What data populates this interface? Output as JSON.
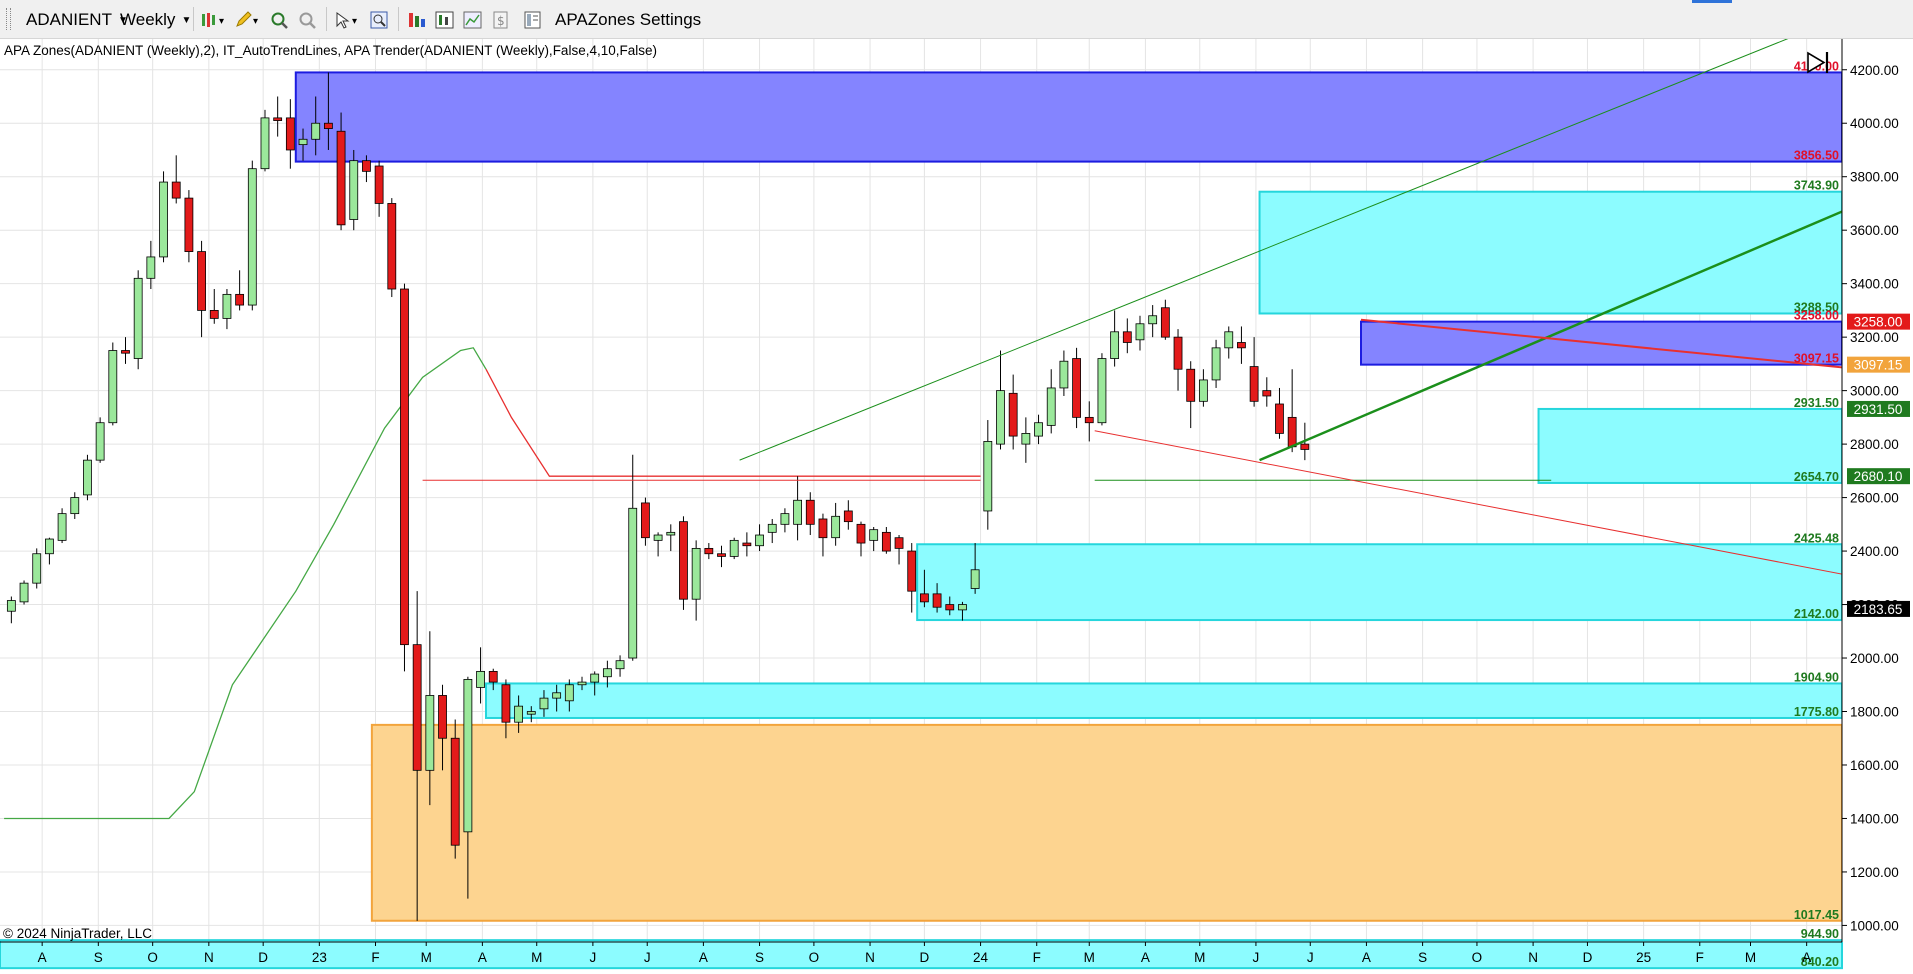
{
  "toolbar": {
    "instrument": "ADANIENT",
    "interval": "Weekly",
    "settings_label": "APAZones Settings"
  },
  "indicator_label": "APA Zones(ADANIENT (Weekly),2),  IT_AutoTrendLines, APA Trender(ADANIENT (Weekly),False,4,10,False)",
  "copyright": "© 2024 NinjaTrader, LLC",
  "colors": {
    "up_candle": "#9be89b",
    "down_candle": "#e31a1a",
    "supply_zone": "#8484ff",
    "demand_zone": "#8cfcff",
    "orange_zone": "#fdd490",
    "trend_green": "#1b8f1b",
    "trend_red": "#e83030"
  },
  "chart_data": {
    "type": "candlestick",
    "y_range": [
      938,
      4315
    ],
    "y_ticks": [
      "1000.00",
      "1200.00",
      "1400.00",
      "1600.00",
      "1800.00",
      "2000.00",
      "2200.00",
      "2400.00",
      "2600.00",
      "2800.00",
      "3000.00",
      "3200.00",
      "3400.00",
      "3600.00",
      "3800.00",
      "4000.00",
      "4200.00"
    ],
    "x_labels": [
      {
        "label": "A",
        "date": "2022-08"
      },
      {
        "label": "S",
        "date": "2022-09"
      },
      {
        "label": "O",
        "date": "2022-10"
      },
      {
        "label": "N",
        "date": "2022-11"
      },
      {
        "label": "D",
        "date": "2022-12"
      },
      {
        "label": "23",
        "date": "2023-01"
      },
      {
        "label": "F",
        "date": "2023-02"
      },
      {
        "label": "M",
        "date": "2023-03"
      },
      {
        "label": "A",
        "date": "2023-04"
      },
      {
        "label": "M",
        "date": "2023-05"
      },
      {
        "label": "J",
        "date": "2023-06"
      },
      {
        "label": "J",
        "date": "2023-07"
      },
      {
        "label": "A",
        "date": "2023-08"
      },
      {
        "label": "S",
        "date": "2023-09"
      },
      {
        "label": "O",
        "date": "2023-10"
      },
      {
        "label": "N",
        "date": "2023-11"
      },
      {
        "label": "D",
        "date": "2023-12"
      },
      {
        "label": "24",
        "date": "2024-01"
      },
      {
        "label": "F",
        "date": "2024-02"
      },
      {
        "label": "M",
        "date": "2024-03"
      },
      {
        "label": "A",
        "date": "2024-04"
      },
      {
        "label": "M",
        "date": "2024-05"
      },
      {
        "label": "J",
        "date": "2024-06"
      },
      {
        "label": "J",
        "date": "2024-07"
      },
      {
        "label": "A",
        "date": "2024-08"
      },
      {
        "label": "S",
        "date": "2024-09"
      },
      {
        "label": "O",
        "date": "2024-10"
      },
      {
        "label": "N",
        "date": "2024-11"
      },
      {
        "label": "D",
        "date": "2024-12"
      },
      {
        "label": "25",
        "date": "2025-01"
      },
      {
        "label": "F",
        "date": "2025-02"
      },
      {
        "label": "M",
        "date": "2025-03"
      },
      {
        "label": "A",
        "date": "2025-04"
      }
    ],
    "zones": [
      {
        "type": "supply",
        "top": 4190.0,
        "bottom": 3856.5,
        "start": "2022-12-19",
        "label_top": "4190.00",
        "label_bottom": "3856.50"
      },
      {
        "type": "demand",
        "top": 3743.9,
        "bottom": 3288.5,
        "start": "2024-06-03",
        "label_top": "3743.90",
        "label_bottom": "3288.50"
      },
      {
        "type": "supply",
        "top": 3258.0,
        "bottom": 3097.15,
        "start": "2024-07-29",
        "label_top": "3258.00",
        "label_bottom": "3097.15"
      },
      {
        "type": "demand",
        "top": 2931.5,
        "bottom": 2654.7,
        "start": "2024-11-04",
        "label_top": "2931.50",
        "label_bottom": "2654.70"
      },
      {
        "type": "demand",
        "top": 2425.48,
        "bottom": 2142.0,
        "start": "2023-11-27",
        "label_top": "2425.48",
        "label_bottom": "2142.00"
      },
      {
        "type": "demand",
        "top": 1904.9,
        "bottom": 1775.8,
        "start": "2023-04-03",
        "label_top": "1904.90",
        "label_bottom": "1775.80"
      },
      {
        "type": "orange",
        "top": 1750.0,
        "bottom": 1017.45,
        "start": "2023-01-30",
        "label_top": "",
        "label_bottom": "1017.45"
      },
      {
        "type": "demand",
        "top": 944.9,
        "bottom": 840.2,
        "start": "2022-07-01",
        "label_top": "944.90",
        "label_bottom": "840.20"
      }
    ],
    "price_badges": [
      {
        "value": 3258.0,
        "label": "3258.00",
        "color": "#e31a1a"
      },
      {
        "value": 3097.15,
        "label": "3097.15",
        "color": "#f2a43c"
      },
      {
        "value": 2931.5,
        "label": "2931.50",
        "color": "#1f7a1f"
      },
      {
        "value": 2680.1,
        "label": "2680.10",
        "color": "#1f7a1f"
      },
      {
        "value": 2183.65,
        "label": "2183.65",
        "color": "#000000"
      }
    ],
    "trendlines": [
      {
        "color": "green",
        "width": 1,
        "points": [
          [
            "2023-08-21",
            2740
          ],
          [
            "2025-04-14",
            4380
          ]
        ]
      },
      {
        "color": "green",
        "width": 2.5,
        "points": [
          [
            "2024-06-03",
            2740
          ],
          [
            "2025-05-01",
            3700
          ]
        ]
      },
      {
        "color": "green",
        "width": 1,
        "points": [
          [
            "2024-03-04",
            2665
          ],
          [
            "2024-11-11",
            2665
          ]
        ]
      },
      {
        "color": "red",
        "width": 1,
        "points": [
          [
            "2024-03-04",
            2850
          ],
          [
            "2025-05-01",
            2300
          ]
        ]
      },
      {
        "color": "red",
        "width": 2,
        "points": [
          [
            "2024-07-29",
            3265
          ],
          [
            "2025-05-01",
            3080
          ]
        ]
      },
      {
        "color": "red",
        "width": 1,
        "points": [
          [
            "2023-02-27",
            2665
          ],
          [
            "2024-01-01",
            2665
          ]
        ]
      }
    ],
    "trender": {
      "green": [
        [
          "2022-07-11",
          1400
        ],
        [
          "2022-10-10",
          1400
        ],
        [
          "2022-10-24",
          1500
        ],
        [
          "2022-11-14",
          1900
        ],
        [
          "2022-12-19",
          2250
        ],
        [
          "2023-01-09",
          2500
        ],
        [
          "2023-02-06",
          2860
        ],
        [
          "2023-02-27",
          3050
        ],
        [
          "2023-03-20",
          3150
        ],
        [
          "2023-03-27",
          3160
        ],
        [
          "2023-04-03",
          3080
        ]
      ],
      "red": [
        [
          "2023-04-03",
          3080
        ],
        [
          "2023-04-17",
          2900
        ],
        [
          "2023-05-08",
          2680
        ],
        [
          "2023-05-29",
          2680
        ],
        [
          "2024-01-01",
          2680
        ]
      ]
    },
    "candles": [
      {
        "d": "2022-07-15",
        "o": 2175,
        "h": 2230,
        "l": 2130,
        "c": 2215
      },
      {
        "d": "2022-07-22",
        "o": 2210,
        "h": 2290,
        "l": 2200,
        "c": 2280
      },
      {
        "d": "2022-07-29",
        "o": 2280,
        "h": 2410,
        "l": 2260,
        "c": 2390
      },
      {
        "d": "2022-08-05",
        "o": 2390,
        "h": 2450,
        "l": 2350,
        "c": 2445
      },
      {
        "d": "2022-08-12",
        "o": 2440,
        "h": 2560,
        "l": 2430,
        "c": 2540
      },
      {
        "d": "2022-08-19",
        "o": 2540,
        "h": 2620,
        "l": 2520,
        "c": 2600
      },
      {
        "d": "2022-08-26",
        "o": 2610,
        "h": 2760,
        "l": 2590,
        "c": 2740
      },
      {
        "d": "2022-09-02",
        "o": 2740,
        "h": 2900,
        "l": 2730,
        "c": 2880
      },
      {
        "d": "2022-09-09",
        "o": 2880,
        "h": 3180,
        "l": 2870,
        "c": 3150
      },
      {
        "d": "2022-09-16",
        "o": 3150,
        "h": 3200,
        "l": 3100,
        "c": 3140
      },
      {
        "d": "2022-09-23",
        "o": 3120,
        "h": 3450,
        "l": 3080,
        "c": 3420
      },
      {
        "d": "2022-09-30",
        "o": 3420,
        "h": 3560,
        "l": 3380,
        "c": 3500
      },
      {
        "d": "2022-10-07",
        "o": 3500,
        "h": 3820,
        "l": 3480,
        "c": 3780
      },
      {
        "d": "2022-10-14",
        "o": 3780,
        "h": 3880,
        "l": 3700,
        "c": 3720
      },
      {
        "d": "2022-10-21",
        "o": 3720,
        "h": 3750,
        "l": 3480,
        "c": 3520
      },
      {
        "d": "2022-10-28",
        "o": 3520,
        "h": 3560,
        "l": 3200,
        "c": 3300
      },
      {
        "d": "2022-11-04",
        "o": 3300,
        "h": 3380,
        "l": 3250,
        "c": 3270
      },
      {
        "d": "2022-11-11",
        "o": 3270,
        "h": 3380,
        "l": 3230,
        "c": 3360
      },
      {
        "d": "2022-11-18",
        "o": 3360,
        "h": 3450,
        "l": 3300,
        "c": 3320
      },
      {
        "d": "2022-11-25",
        "o": 3320,
        "h": 3860,
        "l": 3300,
        "c": 3830
      },
      {
        "d": "2022-12-02",
        "o": 3830,
        "h": 4050,
        "l": 3820,
        "c": 4020
      },
      {
        "d": "2022-12-09",
        "o": 4020,
        "h": 4100,
        "l": 3950,
        "c": 4010
      },
      {
        "d": "2022-12-16",
        "o": 4020,
        "h": 4090,
        "l": 3830,
        "c": 3900
      },
      {
        "d": "2022-12-23",
        "o": 3920,
        "h": 3980,
        "l": 3860,
        "c": 3940
      },
      {
        "d": "2022-12-30",
        "o": 3940,
        "h": 4100,
        "l": 3880,
        "c": 4000
      },
      {
        "d": "2023-01-06",
        "o": 4000,
        "h": 4190,
        "l": 3900,
        "c": 3980
      },
      {
        "d": "2023-01-13",
        "o": 3970,
        "h": 4040,
        "l": 3600,
        "c": 3620
      },
      {
        "d": "2023-01-20",
        "o": 3640,
        "h": 3900,
        "l": 3600,
        "c": 3860
      },
      {
        "d": "2023-01-27",
        "o": 3860,
        "h": 3880,
        "l": 3780,
        "c": 3820
      },
      {
        "d": "2023-02-03",
        "o": 3840,
        "h": 3860,
        "l": 3650,
        "c": 3700
      },
      {
        "d": "2023-02-10",
        "o": 3700,
        "h": 3720,
        "l": 3350,
        "c": 3380
      },
      {
        "d": "2023-02-17",
        "o": 3380,
        "h": 3400,
        "l": 1950,
        "c": 2050
      },
      {
        "d": "2023-02-24",
        "o": 2050,
        "h": 2250,
        "l": 1017,
        "c": 1580
      },
      {
        "d": "2023-03-03",
        "o": 1580,
        "h": 2100,
        "l": 1450,
        "c": 1860
      },
      {
        "d": "2023-03-10",
        "o": 1860,
        "h": 1900,
        "l": 1580,
        "c": 1700
      },
      {
        "d": "2023-03-17",
        "o": 1700,
        "h": 1770,
        "l": 1250,
        "c": 1300
      },
      {
        "d": "2023-03-24",
        "o": 1350,
        "h": 1930,
        "l": 1100,
        "c": 1920
      },
      {
        "d": "2023-03-31",
        "o": 1890,
        "h": 2040,
        "l": 1830,
        "c": 1950
      },
      {
        "d": "2023-04-07",
        "o": 1950,
        "h": 1960,
        "l": 1880,
        "c": 1910
      },
      {
        "d": "2023-04-14",
        "o": 1900,
        "h": 1920,
        "l": 1700,
        "c": 1760
      },
      {
        "d": "2023-04-21",
        "o": 1760,
        "h": 1860,
        "l": 1720,
        "c": 1820
      },
      {
        "d": "2023-04-28",
        "o": 1790,
        "h": 1820,
        "l": 1760,
        "c": 1800
      },
      {
        "d": "2023-05-05",
        "o": 1810,
        "h": 1880,
        "l": 1780,
        "c": 1850
      },
      {
        "d": "2023-05-12",
        "o": 1850,
        "h": 1900,
        "l": 1800,
        "c": 1870
      },
      {
        "d": "2023-05-19",
        "o": 1840,
        "h": 1920,
        "l": 1800,
        "c": 1900
      },
      {
        "d": "2023-05-26",
        "o": 1900,
        "h": 1930,
        "l": 1880,
        "c": 1910
      },
      {
        "d": "2023-06-02",
        "o": 1910,
        "h": 1950,
        "l": 1860,
        "c": 1940
      },
      {
        "d": "2023-06-09",
        "o": 1930,
        "h": 1990,
        "l": 1890,
        "c": 1960
      },
      {
        "d": "2023-06-16",
        "o": 1960,
        "h": 2010,
        "l": 1930,
        "c": 1990
      },
      {
        "d": "2023-06-23",
        "o": 2000,
        "h": 2760,
        "l": 1990,
        "c": 2560
      },
      {
        "d": "2023-06-30",
        "o": 2580,
        "h": 2600,
        "l": 2420,
        "c": 2450
      },
      {
        "d": "2023-07-07",
        "o": 2440,
        "h": 2470,
        "l": 2380,
        "c": 2460
      },
      {
        "d": "2023-07-14",
        "o": 2460,
        "h": 2500,
        "l": 2400,
        "c": 2470
      },
      {
        "d": "2023-07-21",
        "o": 2510,
        "h": 2530,
        "l": 2180,
        "c": 2220
      },
      {
        "d": "2023-07-28",
        "o": 2220,
        "h": 2440,
        "l": 2140,
        "c": 2410
      },
      {
        "d": "2023-08-04",
        "o": 2410,
        "h": 2430,
        "l": 2370,
        "c": 2390
      },
      {
        "d": "2023-08-11",
        "o": 2390,
        "h": 2420,
        "l": 2340,
        "c": 2380
      },
      {
        "d": "2023-08-18",
        "o": 2380,
        "h": 2450,
        "l": 2370,
        "c": 2440
      },
      {
        "d": "2023-08-25",
        "o": 2430,
        "h": 2470,
        "l": 2380,
        "c": 2420
      },
      {
        "d": "2023-09-01",
        "o": 2420,
        "h": 2500,
        "l": 2400,
        "c": 2460
      },
      {
        "d": "2023-09-08",
        "o": 2470,
        "h": 2520,
        "l": 2430,
        "c": 2500
      },
      {
        "d": "2023-09-15",
        "o": 2500,
        "h": 2560,
        "l": 2470,
        "c": 2540
      },
      {
        "d": "2023-09-22",
        "o": 2500,
        "h": 2680,
        "l": 2440,
        "c": 2590
      },
      {
        "d": "2023-09-29",
        "o": 2590,
        "h": 2620,
        "l": 2460,
        "c": 2500
      },
      {
        "d": "2023-10-06",
        "o": 2520,
        "h": 2540,
        "l": 2380,
        "c": 2450
      },
      {
        "d": "2023-10-13",
        "o": 2450,
        "h": 2580,
        "l": 2420,
        "c": 2530
      },
      {
        "d": "2023-10-20",
        "o": 2550,
        "h": 2590,
        "l": 2480,
        "c": 2510
      },
      {
        "d": "2023-10-27",
        "o": 2500,
        "h": 2510,
        "l": 2380,
        "c": 2430
      },
      {
        "d": "2023-11-03",
        "o": 2440,
        "h": 2490,
        "l": 2400,
        "c": 2480
      },
      {
        "d": "2023-11-10",
        "o": 2470,
        "h": 2490,
        "l": 2390,
        "c": 2400
      },
      {
        "d": "2023-11-17",
        "o": 2450,
        "h": 2460,
        "l": 2350,
        "c": 2410
      },
      {
        "d": "2023-11-24",
        "o": 2400,
        "h": 2430,
        "l": 2170,
        "c": 2250
      },
      {
        "d": "2023-12-01",
        "o": 2240,
        "h": 2330,
        "l": 2190,
        "c": 2210
      },
      {
        "d": "2023-12-08",
        "o": 2240,
        "h": 2280,
        "l": 2170,
        "c": 2190
      },
      {
        "d": "2023-12-15",
        "o": 2200,
        "h": 2230,
        "l": 2160,
        "c": 2180
      },
      {
        "d": "2023-12-22",
        "o": 2180,
        "h": 2210,
        "l": 2140,
        "c": 2200
      },
      {
        "d": "2023-12-29",
        "o": 2260,
        "h": 2430,
        "l": 2240,
        "c": 2330
      },
      {
        "d": "2024-01-05",
        "o": 2550,
        "h": 2890,
        "l": 2480,
        "c": 2810
      },
      {
        "d": "2024-01-12",
        "o": 2800,
        "h": 3150,
        "l": 2780,
        "c": 3000
      },
      {
        "d": "2024-01-19",
        "o": 2990,
        "h": 3060,
        "l": 2780,
        "c": 2830
      },
      {
        "d": "2024-01-26",
        "o": 2800,
        "h": 2900,
        "l": 2730,
        "c": 2840
      },
      {
        "d": "2024-02-02",
        "o": 2830,
        "h": 2910,
        "l": 2800,
        "c": 2880
      },
      {
        "d": "2024-02-09",
        "o": 2870,
        "h": 3080,
        "l": 2840,
        "c": 3010
      },
      {
        "d": "2024-02-16",
        "o": 3010,
        "h": 3150,
        "l": 2980,
        "c": 3110
      },
      {
        "d": "2024-02-23",
        "o": 3120,
        "h": 3160,
        "l": 2860,
        "c": 2900
      },
      {
        "d": "2024-03-01",
        "o": 2900,
        "h": 2960,
        "l": 2810,
        "c": 2880
      },
      {
        "d": "2024-03-08",
        "o": 2880,
        "h": 3140,
        "l": 2870,
        "c": 3120
      },
      {
        "d": "2024-03-15",
        "o": 3120,
        "h": 3300,
        "l": 3090,
        "c": 3220
      },
      {
        "d": "2024-03-22",
        "o": 3220,
        "h": 3270,
        "l": 3140,
        "c": 3180
      },
      {
        "d": "2024-03-29",
        "o": 3190,
        "h": 3280,
        "l": 3150,
        "c": 3250
      },
      {
        "d": "2024-04-05",
        "o": 3250,
        "h": 3320,
        "l": 3200,
        "c": 3280
      },
      {
        "d": "2024-04-12",
        "o": 3310,
        "h": 3340,
        "l": 3190,
        "c": 3200
      },
      {
        "d": "2024-04-19",
        "o": 3200,
        "h": 3230,
        "l": 3000,
        "c": 3080
      },
      {
        "d": "2024-04-26",
        "o": 3080,
        "h": 3110,
        "l": 2860,
        "c": 2960
      },
      {
        "d": "2024-05-03",
        "o": 2960,
        "h": 3080,
        "l": 2940,
        "c": 3040
      },
      {
        "d": "2024-05-10",
        "o": 3040,
        "h": 3190,
        "l": 3010,
        "c": 3160
      },
      {
        "d": "2024-05-17",
        "o": 3160,
        "h": 3240,
        "l": 3120,
        "c": 3220
      },
      {
        "d": "2024-05-24",
        "o": 3180,
        "h": 3240,
        "l": 3100,
        "c": 3160
      },
      {
        "d": "2024-05-31",
        "o": 3090,
        "h": 3200,
        "l": 2940,
        "c": 2960
      },
      {
        "d": "2024-06-07",
        "o": 3000,
        "h": 3050,
        "l": 2940,
        "c": 2980
      },
      {
        "d": "2024-06-14",
        "o": 2950,
        "h": 3010,
        "l": 2820,
        "c": 2840
      },
      {
        "d": "2024-06-21",
        "o": 2900,
        "h": 3080,
        "l": 2770,
        "c": 2790
      },
      {
        "d": "2024-06-28",
        "o": 2800,
        "h": 2880,
        "l": 2740,
        "c": 2780
      }
    ]
  }
}
